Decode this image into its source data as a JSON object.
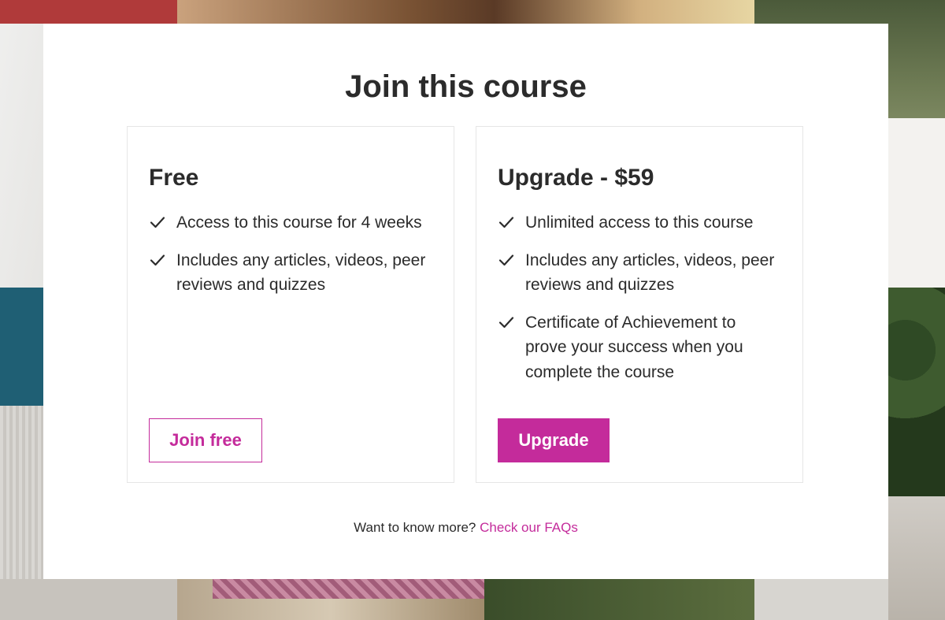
{
  "modal": {
    "title": "Join this course",
    "plans": [
      {
        "name": "Free",
        "features": [
          "Access to this course for 4 weeks",
          "Includes any articles, videos, peer reviews and quizzes"
        ],
        "button_label": "Join free"
      },
      {
        "name": "Upgrade - $59",
        "features": [
          "Unlimited access to this course",
          "Includes any articles, videos, peer reviews and quizzes",
          "Certificate of Achievement to prove your success when you complete the course"
        ],
        "button_label": "Upgrade"
      }
    ],
    "footer": {
      "text": "Want to know more?",
      "link_label": "Check our FAQs"
    }
  },
  "icons": {
    "feature_bullet": "check-icon"
  },
  "colors": {
    "accent": "#c42b9b",
    "text": "#2b2b2b",
    "card_border": "#e6e6e6"
  }
}
